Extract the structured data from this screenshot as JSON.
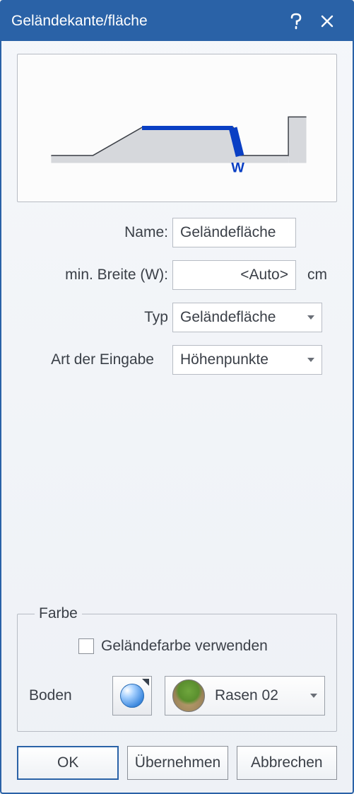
{
  "title": "Geländekante/fläche",
  "diagram": {
    "w_label": "W"
  },
  "fields": {
    "name_label": "Name:",
    "name_value": "Geländefläche",
    "width_label": "min. Breite (W):",
    "width_value": "<Auto>",
    "width_unit": "cm",
    "type_label": "Typ",
    "type_value": "Geländefläche",
    "input_label": "Art der Eingabe",
    "input_value": "Höhenpunkte"
  },
  "color_group": {
    "legend": "Farbe",
    "use_terrain_checkbox_label": "Geländefarbe verwenden",
    "use_terrain_checked": false,
    "ground_label": "Boden",
    "texture_value": "Rasen 02"
  },
  "buttons": {
    "ok": "OK",
    "apply": "Übernehmen",
    "cancel": "Abbrechen"
  }
}
